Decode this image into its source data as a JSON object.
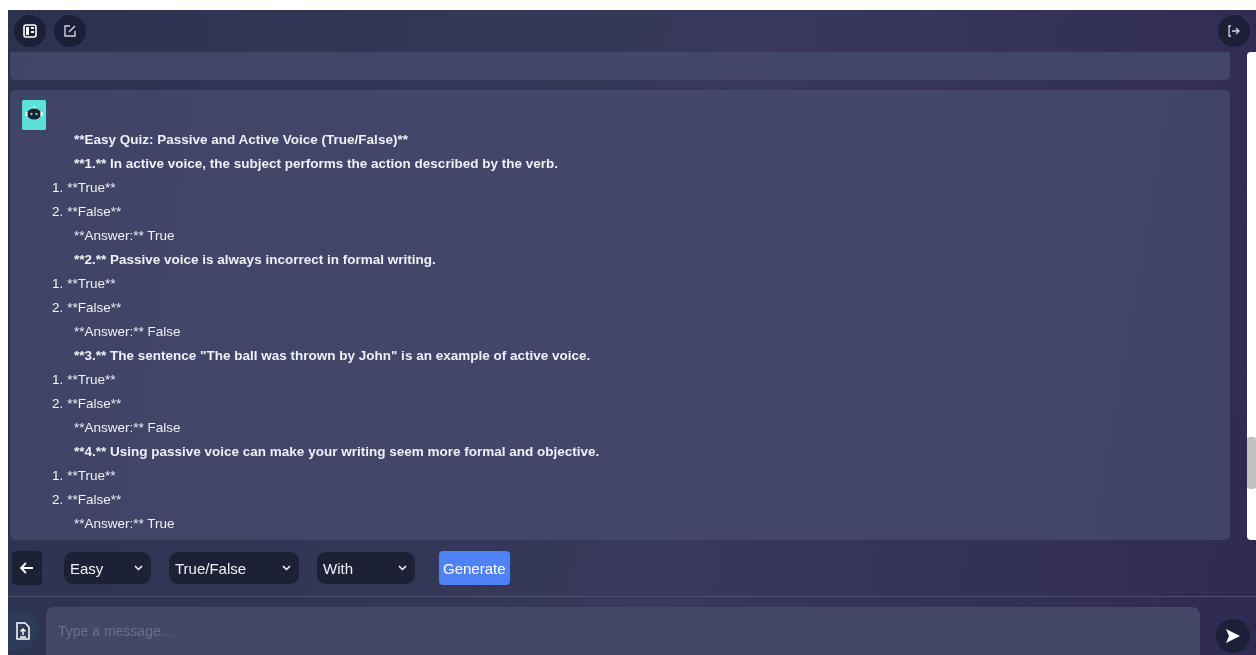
{
  "quiz_lines": [
    {
      "kind": "heading",
      "text": "**Easy Quiz: Passive and Active Voice (True/False)**"
    },
    {
      "kind": "question",
      "text": "**1.** In active voice, the subject performs the action described by the verb."
    },
    {
      "kind": "option",
      "number": "1.",
      "text": "**True**"
    },
    {
      "kind": "option",
      "number": "2.",
      "text": "**False**"
    },
    {
      "kind": "answer",
      "text": "**Answer:** True"
    },
    {
      "kind": "question",
      "text": "**2.** Passive voice is always incorrect in formal writing."
    },
    {
      "kind": "option",
      "number": "1.",
      "text": "**True**"
    },
    {
      "kind": "option",
      "number": "2.",
      "text": "**False**"
    },
    {
      "kind": "answer",
      "text": "**Answer:** False"
    },
    {
      "kind": "question",
      "text": "**3.** The sentence \"The ball was thrown by John\" is an example of active voice."
    },
    {
      "kind": "option",
      "number": "1.",
      "text": "**True**"
    },
    {
      "kind": "option",
      "number": "2.",
      "text": "**False**"
    },
    {
      "kind": "answer",
      "text": "**Answer:** False"
    },
    {
      "kind": "question",
      "text": "**4.** Using passive voice can make your writing seem more formal and objective."
    },
    {
      "kind": "option",
      "number": "1.",
      "text": "**True**"
    },
    {
      "kind": "option",
      "number": "2.",
      "text": "**False**"
    },
    {
      "kind": "answer",
      "text": "**Answer:** True"
    }
  ],
  "toolbar": {
    "selects": [
      {
        "value": "Easy"
      },
      {
        "value": "True/False"
      },
      {
        "value": "With"
      }
    ],
    "generate_button": "Generate"
  },
  "input": {
    "placeholder": "Type a message..."
  }
}
